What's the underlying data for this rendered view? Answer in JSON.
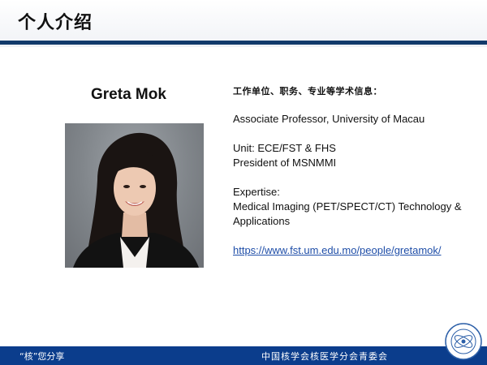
{
  "header": {
    "title": "个人介绍"
  },
  "profile": {
    "name": "Greta Mok",
    "heading": "工作单位、职务、专业等学术信息：",
    "position": "Associate Professor, University of Macau",
    "unit": "Unit: ECE/FST & FHS",
    "president": "President of MSNMMI",
    "expertise_label": "Expertise:",
    "expertise_value": "Medical Imaging (PET/SPECT/CT) Technology & Applications",
    "url": "https://www.fst.um.edu.mo/people/gretamok/"
  },
  "footer": {
    "left_text": "“核”您分享",
    "right_text": "中国核学会核医学分会青委会"
  },
  "colors": {
    "accent": "#123a6b",
    "footer_bg": "#0b3d8c",
    "link": "#1f4ea8"
  }
}
